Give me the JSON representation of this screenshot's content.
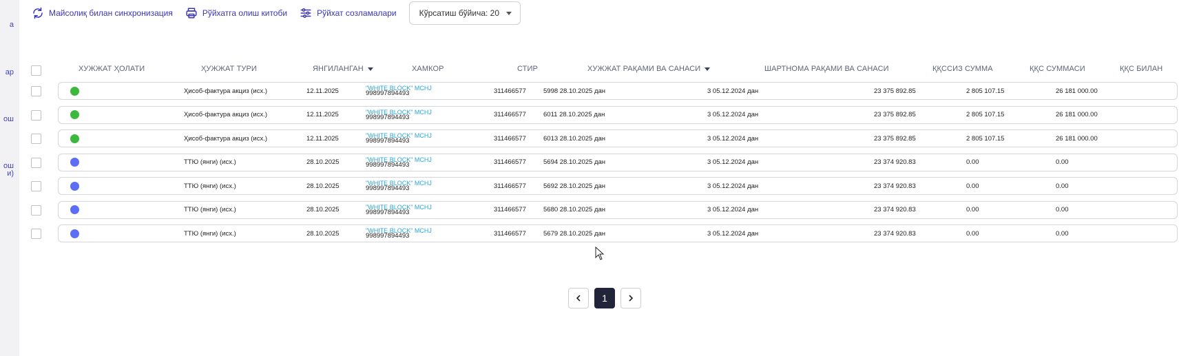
{
  "sidebar_fragments": [
    "а",
    "ар",
    "ош",
    "ош",
    "и)"
  ],
  "toolbar": {
    "sync_label": "Майсолиқ билан синхронизация",
    "print_label": "Рўйхатга олиш китоби",
    "settings_label": "Рўйхат созламалари",
    "page_size_label": "Кўрсатиш бўйича: 20"
  },
  "columns": {
    "status": "ХУЖЖАТ ҲОЛАТИ",
    "type": "ҲУЖЖАТ ТУРИ",
    "updated": "ЯНГИЛАНГАН",
    "partner": "ХАМКОР",
    "inn": "СТИР",
    "doc_number": "ХУЖЖАТ РАҚАМИ ВА САНАСИ",
    "contract": "ШАРТНОМА РАҚАМИ ВА САНАСИ",
    "sum_no_vat": "ҚҚССИЗ СУММА",
    "vat_sum": "ҚҚС СУММАСИ",
    "total_vat": "ҚҚС БИЛАН"
  },
  "colors": {
    "green": "#3cb93c",
    "blue": "#5b6ef5",
    "accent": "#3a34b8"
  },
  "rows": [
    {
      "status": "green",
      "type": "Ҳисоб-фактура акциз (исх.)",
      "updated": "12.11.2025",
      "partner_name": "\"WHITE BLOCK\" MCHJ",
      "partner_phone": "998997894493",
      "inn": "311466577",
      "doc": "5998 28.10.2025 дан",
      "contract": "3 05.12.2024 дан",
      "sum": "23 375 892.85",
      "vat": "2 805 107.15",
      "total": "26 181 000.00"
    },
    {
      "status": "green",
      "type": "Ҳисоб-фактура акциз (исх.)",
      "updated": "12.11.2025",
      "partner_name": "\"WHITE BLOCK\" MCHJ",
      "partner_phone": "998997894493",
      "inn": "311466577",
      "doc": "6011 28.10.2025 дан",
      "contract": "3 05.12.2024 дан",
      "sum": "23 375 892.85",
      "vat": "2 805 107.15",
      "total": "26 181 000.00"
    },
    {
      "status": "green",
      "type": "Ҳисоб-фактура акциз (исх.)",
      "updated": "12.11.2025",
      "partner_name": "\"WHITE BLOCK\" MCHJ",
      "partner_phone": "998997894493",
      "inn": "311466577",
      "doc": "6013 28.10.2025 дан",
      "contract": "3 05.12.2024 дан",
      "sum": "23 375 892.85",
      "vat": "2 805 107.15",
      "total": "26 181 000.00"
    },
    {
      "status": "blue",
      "type": "ТТЮ (янги) (исх.)",
      "updated": "28.10.2025",
      "partner_name": "\"WHITE BLOCK\" MCHJ",
      "partner_phone": "998997894493",
      "inn": "311466577",
      "doc": "5694 28.10.2025 дан",
      "contract": "3 05.12.2024 дан",
      "sum": "23 374 920.83",
      "vat": "0.00",
      "total": "0.00"
    },
    {
      "status": "blue",
      "type": "ТТЮ (янги) (исх.)",
      "updated": "28.10.2025",
      "partner_name": "\"WHITE BLOCK\" MCHJ",
      "partner_phone": "998997894493",
      "inn": "311466577",
      "doc": "5692 28.10.2025 дан",
      "contract": "3 05.12.2024 дан",
      "sum": "23 374 920.83",
      "vat": "0.00",
      "total": "0.00"
    },
    {
      "status": "blue",
      "type": "ТТЮ (янги) (исх.)",
      "updated": "28.10.2025",
      "partner_name": "\"WHITE BLOCK\" MCHJ",
      "partner_phone": "998997894493",
      "inn": "311466577",
      "doc": "5680 28.10.2025 дан",
      "contract": "3 05.12.2024 дан",
      "sum": "23 374 920.83",
      "vat": "0.00",
      "total": "0.00"
    },
    {
      "status": "blue",
      "type": "ТТЮ (янги) (исх.)",
      "updated": "28.10.2025",
      "partner_name": "\"WHITE BLOCK\" MCHJ",
      "partner_phone": "998997894493",
      "inn": "311466577",
      "doc": "5679 28.10.2025 дан",
      "contract": "3 05.12.2024 дан",
      "sum": "23 374 920.83",
      "vat": "0.00",
      "total": "0.00"
    }
  ],
  "pagination": {
    "current_page": "1"
  }
}
